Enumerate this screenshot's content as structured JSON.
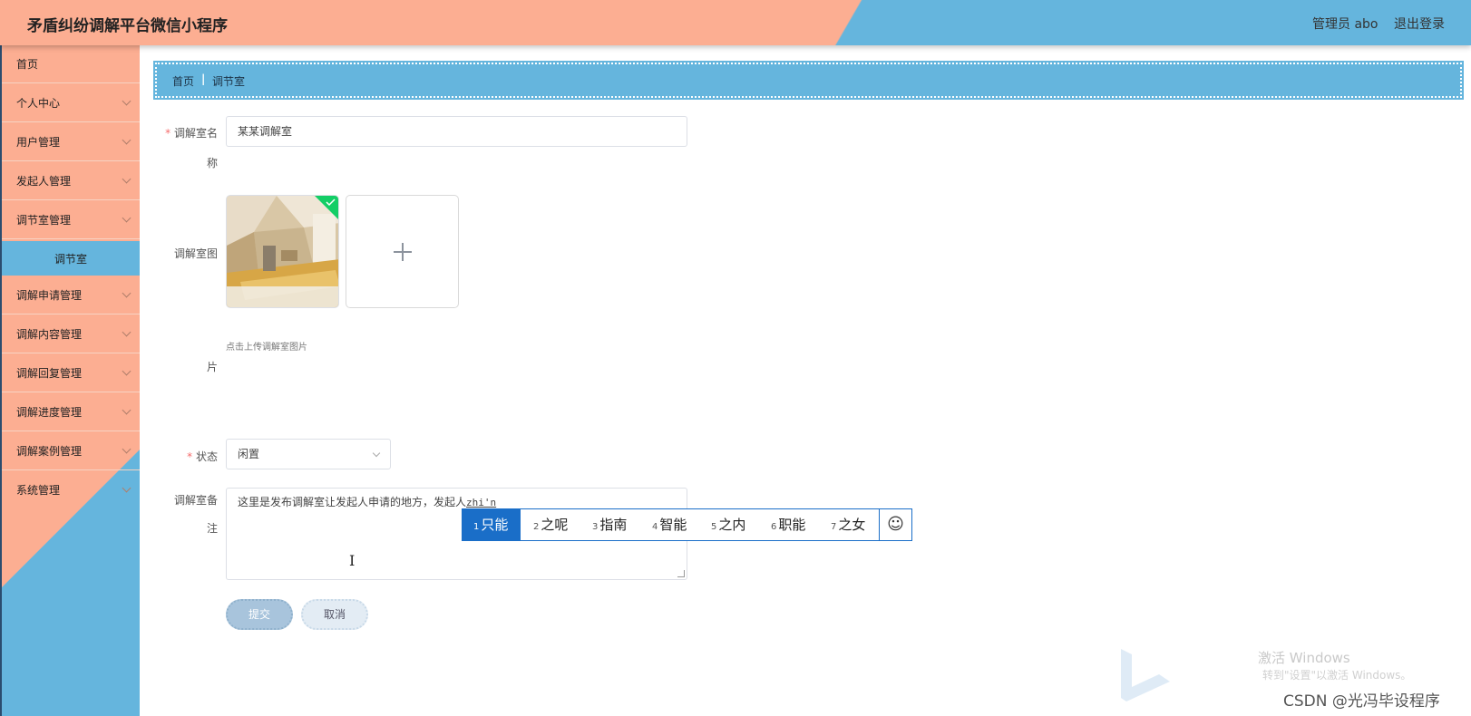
{
  "header": {
    "app_title": "矛盾纠纷调解平台微信小程序",
    "admin_label": "管理员 abo",
    "logout_label": "退出登录"
  },
  "sidebar": {
    "items": [
      {
        "label": "首页",
        "expandable": false
      },
      {
        "label": "个人中心",
        "expandable": true
      },
      {
        "label": "用户管理",
        "expandable": true
      },
      {
        "label": "发起人管理",
        "expandable": true
      },
      {
        "label": "调节室管理",
        "expandable": true
      },
      {
        "label": "调解申请管理",
        "expandable": true
      },
      {
        "label": "调解内容管理",
        "expandable": true
      },
      {
        "label": "调解回复管理",
        "expandable": true
      },
      {
        "label": "调解进度管理",
        "expandable": true
      },
      {
        "label": "调解案例管理",
        "expandable": true
      },
      {
        "label": "系统管理",
        "expandable": true
      }
    ],
    "active_sub_item": "调节室"
  },
  "breadcrumb": {
    "home": "首页",
    "separator": "|",
    "current": "调节室"
  },
  "form": {
    "name": {
      "label_line1": "调解室名",
      "label_line2": "称",
      "required_mark": "*",
      "value": "某某调解室"
    },
    "image": {
      "label_line1": "调解室图",
      "label_line2": "片",
      "hint": "点击上传调解室图片",
      "add_symbol": "+"
    },
    "status": {
      "label": "状态",
      "required_mark": "*",
      "value": "闲置"
    },
    "remark": {
      "label_line1": "调解室备",
      "label_line2": "注",
      "value": "这里是发布调解室让发起人申请的地方，发起人",
      "composing": "zhi'n"
    },
    "submit_label": "提交",
    "cancel_label": "取消"
  },
  "ime": {
    "candidates": [
      {
        "num": "1",
        "text": "只能",
        "selected": true
      },
      {
        "num": "2",
        "text": "之呢",
        "selected": false
      },
      {
        "num": "3",
        "text": "指南",
        "selected": false
      },
      {
        "num": "4",
        "text": "智能",
        "selected": false
      },
      {
        "num": "5",
        "text": "之内",
        "selected": false
      },
      {
        "num": "6",
        "text": "职能",
        "selected": false
      },
      {
        "num": "7",
        "text": "之女",
        "selected": false
      }
    ],
    "emoji_glyph": "☺"
  },
  "watermark": {
    "windows_line1": "激活 Windows",
    "windows_line2": "转到\"设置\"以激活 Windows。",
    "csdn": "CSDN @光冯毕设程序"
  },
  "colors": {
    "salmon": "#fcae92",
    "sky_blue": "#65b5dd",
    "ime_blue": "#1a6ec8",
    "required_red": "#f56c6c"
  }
}
